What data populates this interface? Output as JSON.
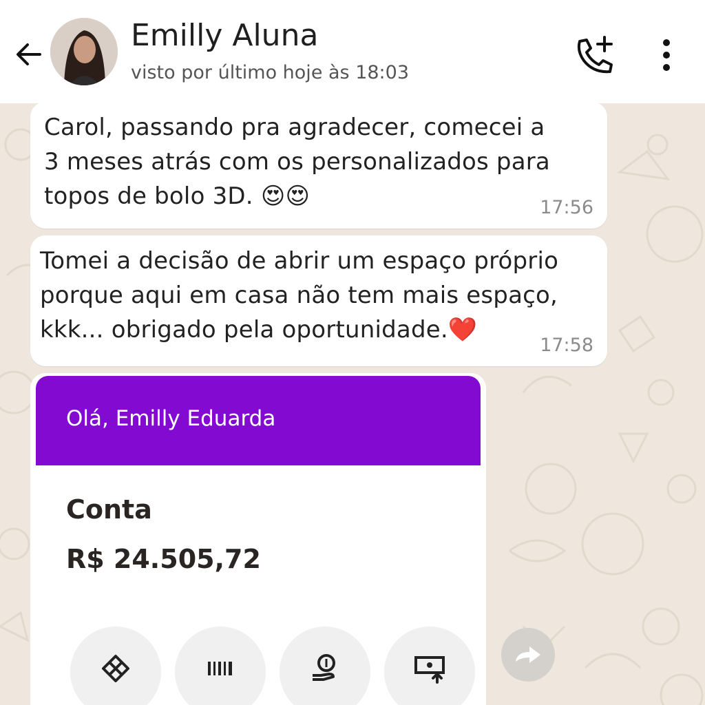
{
  "header": {
    "contact_name": "Emilly Aluna",
    "last_seen": "visto por último hoje às 18:03",
    "icons": [
      "back-arrow-icon",
      "add-call-icon",
      "more-vertical-icon"
    ]
  },
  "messages": [
    {
      "lines": [
        "Carol, passando pra agradecer, comecei a",
        "3 meses atrás com os personalizados para",
        "topos de bolo 3D. 😍😍"
      ],
      "time": "17:56"
    },
    {
      "lines": [
        "Tomei a decisão de abrir um espaço próprio",
        "porque aqui em casa não tem mais espaço,",
        "kkk... obrigado pela oportunidade.❤️"
      ],
      "time": "17:58"
    }
  ],
  "bank_card": {
    "greeting": "Olá, Emilly Eduarda",
    "title": "Conta",
    "amount": "R$ 24.505,72",
    "accent": "#820ad1",
    "actions": [
      "pix-icon",
      "barcode-icon",
      "deposit-icon",
      "transfer-icon"
    ]
  },
  "colors": {
    "chat_background": "#efe7dd",
    "bubble": "#ffffff"
  }
}
